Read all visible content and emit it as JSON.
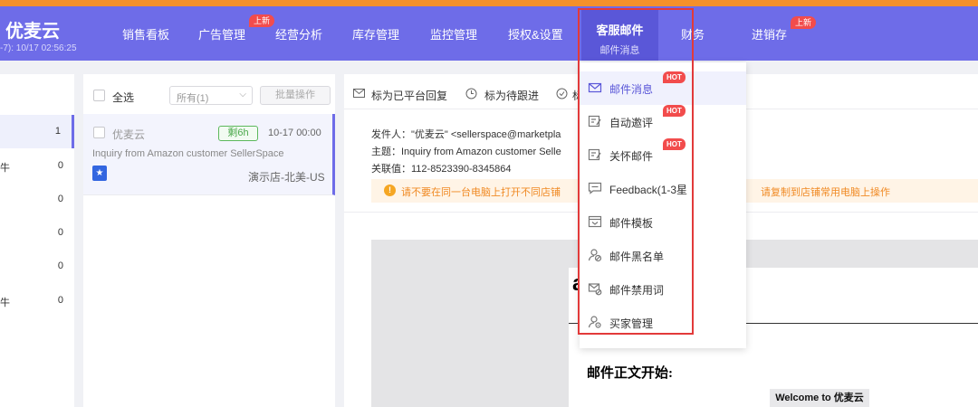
{
  "header": {
    "brand": "优麦云",
    "time": "-7): 10/17 02:56:25",
    "nav": [
      {
        "label": "销售看板"
      },
      {
        "label": "广告管理",
        "badge": "上新"
      },
      {
        "label": "经营分析"
      },
      {
        "label": "库存管理"
      },
      {
        "label": "监控管理"
      },
      {
        "label": "授权&设置"
      },
      {
        "label": "客服邮件",
        "sub": "邮件消息"
      },
      {
        "label": "财务"
      },
      {
        "label": "进销存",
        "badge": "上新"
      }
    ]
  },
  "folders": [
    {
      "label": "",
      "count": "1"
    },
    {
      "label": "牛",
      "count": "0"
    },
    {
      "label": "",
      "count": "0"
    },
    {
      "label": "",
      "count": "0"
    },
    {
      "label": "",
      "count": "0"
    },
    {
      "label": "牛",
      "count": "0"
    }
  ],
  "list": {
    "select_all": "全选",
    "filter_value": "所有(1)",
    "batch_label": "批量操作",
    "message": {
      "sender": "优麦云",
      "remaining": "剩6h",
      "date": "10-17 00:00",
      "subject": "Inquiry from Amazon customer SellerSpace",
      "store": "演示店-北美-US"
    }
  },
  "detail": {
    "toolbar": {
      "replied": "标为已平台回复",
      "follow": "标为待跟进",
      "more": "标"
    },
    "sender_line": "发件人：\"优麦云\" <sellerspace@marketpla",
    "subject_line": "主题：Inquiry from Amazon customer Selle",
    "related_line": "关联值：112-8523390-8345864",
    "warning_left": "请不要在同一台电脑上打开不同店铺",
    "warning_right": "请复制到店铺常用电脑上操作",
    "body_letter": "a",
    "body_start": "邮件正文开始:",
    "welcome": "Welcome to 优麦云"
  },
  "menu": {
    "items": [
      {
        "label": "邮件消息",
        "icon": "mail-icon",
        "hot": "HOT"
      },
      {
        "label": "自动邀评",
        "icon": "edit-list-icon",
        "hot": "HOT"
      },
      {
        "label": "关怀邮件",
        "icon": "edit-list-icon",
        "hot": "HOT"
      },
      {
        "label": "Feedback(1-3星",
        "icon": "chat-icon"
      },
      {
        "label": "邮件模板",
        "icon": "template-icon"
      },
      {
        "label": "邮件黑名单",
        "icon": "user-block-icon"
      },
      {
        "label": "邮件禁用词",
        "icon": "mail-block-icon"
      },
      {
        "label": "买家管理",
        "icon": "user-manage-icon"
      }
    ]
  },
  "colors": {
    "topbar": "#6e6ce8",
    "accent_strip": "#f5902a",
    "highlight_box": "#e23a3a",
    "hot_badge": "#f24c4c"
  }
}
